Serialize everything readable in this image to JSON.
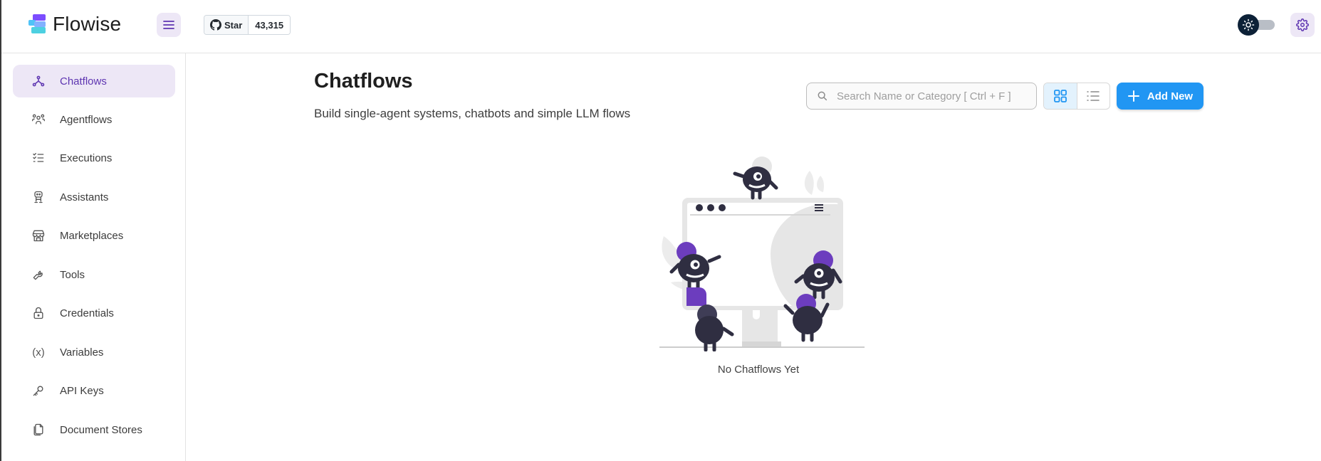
{
  "app": {
    "name": "Flowise"
  },
  "header": {
    "menu_icon": "hamburger-menu-icon",
    "github": {
      "star_label": "Star",
      "star_count": "43,315",
      "icon": "github-icon"
    },
    "theme_icon": "sun-icon",
    "settings_icon": "gear-icon"
  },
  "sidebar": {
    "items": [
      {
        "label": "Chatflows",
        "icon": "chatflow-icon",
        "active": true
      },
      {
        "label": "Agentflows",
        "icon": "users-group-icon"
      },
      {
        "label": "Executions",
        "icon": "list-check-icon"
      },
      {
        "label": "Assistants",
        "icon": "robot-icon"
      },
      {
        "label": "Marketplaces",
        "icon": "storefront-icon"
      },
      {
        "label": "Tools",
        "icon": "wrench-icon"
      },
      {
        "label": "Credentials",
        "icon": "lock-icon"
      },
      {
        "label": "Variables",
        "icon": "variable-icon"
      },
      {
        "label": "API Keys",
        "icon": "key-icon"
      },
      {
        "label": "Document Stores",
        "icon": "files-icon"
      }
    ],
    "variables_glyph": "(x)"
  },
  "main": {
    "title": "Chatflows",
    "subtitle": "Build single-agent systems, chatbots and simple LLM flows",
    "search": {
      "placeholder": "Search Name or Category [ Ctrl + F ]",
      "value": ""
    },
    "view_toggle": {
      "selected": "card",
      "options": [
        "card-view-icon",
        "list-view-icon"
      ]
    },
    "add_button": {
      "label": "Add New",
      "icon": "plus-icon"
    },
    "empty_state": {
      "text": "No Chatflows Yet"
    }
  },
  "colors": {
    "primary": "#2196f3",
    "secondary": "#5e35b1",
    "secondary_light": "#ede7f6",
    "illustration_purple": "#6c3dbe",
    "illustration_dark": "#2f2e41"
  }
}
